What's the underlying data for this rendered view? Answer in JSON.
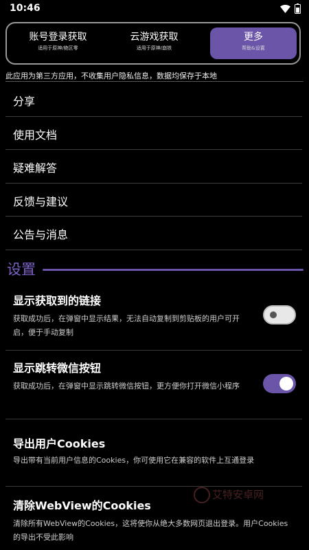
{
  "status": {
    "time": "10:46"
  },
  "tabs": [
    {
      "title": "账号登录获取",
      "subtitle": "适用于原神/绝区零"
    },
    {
      "title": "云游戏获取",
      "subtitle": "适用于原神/崩铁"
    },
    {
      "title": "更多",
      "subtitle": "帮助&设置"
    }
  ],
  "notice": "此应用为第三方应用，不收集用户隐私信息，数据均保存于本地",
  "menu": [
    "分享",
    "使用文档",
    "疑难解答",
    "反馈与建议",
    "公告与消息"
  ],
  "settings_header": "设置",
  "settings": [
    {
      "title": "显示获取到的链接",
      "desc": "获取成功后，在弹窗中显示结果，无法自动复制到剪贴板的用户可开启，便于手动复制",
      "enabled": false
    },
    {
      "title": "显示跳转微信按钮",
      "desc": "获取成功后，在弹窗中显示跳转微信按钮，更方便你打开微信小程序",
      "enabled": true
    },
    {
      "title": "导出用户Cookies",
      "desc": "导出带有当前用户信息的Cookies，你可使用它在兼容的软件上互通登录"
    },
    {
      "title": "清除WebView的Cookies",
      "desc": "清除所有WebView的Cookies，这将使你从绝大多数网页退出登录。用户Cookies的导出不受此影响"
    }
  ],
  "watermark": "艾特安卓网",
  "colors": {
    "accent": "#6b55a8",
    "background": "#000000"
  }
}
